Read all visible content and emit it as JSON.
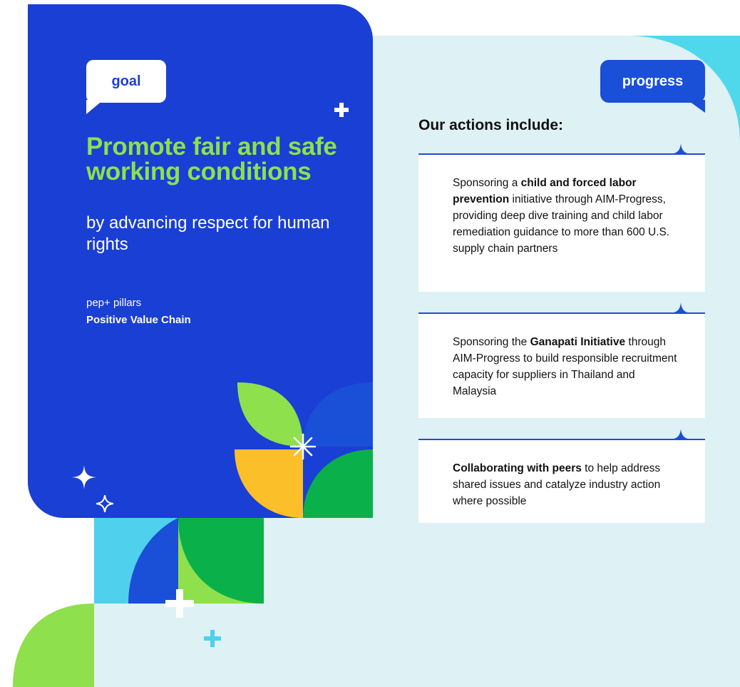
{
  "goal": {
    "badge": "goal",
    "headline": "Promote fair and safe working conditions",
    "subheadline": "by advancing respect for human rights",
    "pillars_label": "pep+ pillars",
    "pillars_value": "Positive Value Chain"
  },
  "progress": {
    "badge": "progress",
    "actions_title": "Our actions include:",
    "actions": [
      {
        "before": "Sponsoring a ",
        "bold": "child and forced labor prevention",
        "after": " initiative through AIM-Progress, providing deep dive training and child labor remediation guidance to more than 600 U.S. supply chain partners"
      },
      {
        "before": "Sponsoring the ",
        "bold": "Ganapati Initiative",
        "after": " through AIM-Progress to build responsible recruitment capacity for suppliers in Thailand and Malaysia"
      },
      {
        "before": "",
        "bold": "Collaborating with peers",
        "after": " to help address shared issues and catalyze industry action where possible"
      }
    ]
  },
  "colors": {
    "card_blue": "#1a3fd4",
    "accent_green": "#8ee04c",
    "panel_bg": "#def1f4",
    "progress_blue": "#1a4fd8"
  }
}
